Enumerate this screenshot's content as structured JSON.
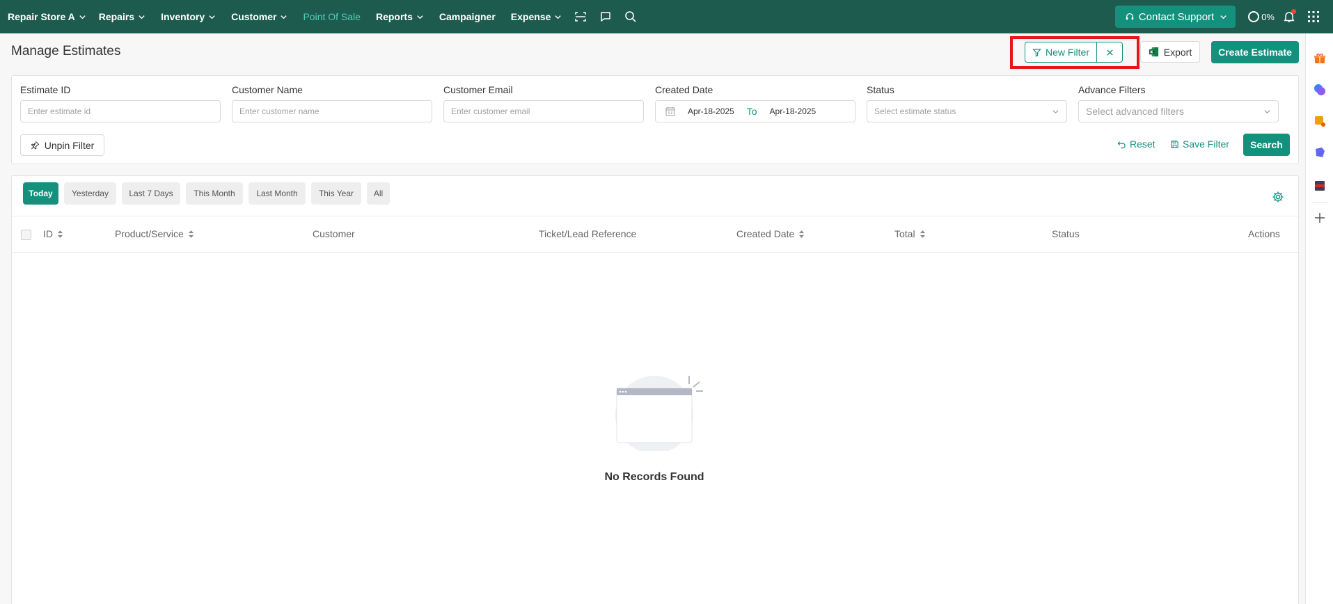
{
  "nav": {
    "store": "Repair Store A",
    "items": [
      {
        "label": "Repairs",
        "dropdown": true
      },
      {
        "label": "Inventory",
        "dropdown": true
      },
      {
        "label": "Customer",
        "dropdown": true
      },
      {
        "label": "Point Of Sale",
        "dropdown": false,
        "active": true
      },
      {
        "label": "Reports",
        "dropdown": true
      },
      {
        "label": "Campaigner",
        "dropdown": false
      },
      {
        "label": "Expense",
        "dropdown": true
      }
    ],
    "icons": [
      "scan-icon",
      "chat-icon",
      "search-icon"
    ],
    "contact_support": "Contact Support",
    "progress": "0%"
  },
  "page": {
    "title": "Manage Estimates",
    "new_filter": "New Filter",
    "export": "Export",
    "create": "Create Estimate"
  },
  "filters": {
    "estimate_id": {
      "label": "Estimate ID",
      "placeholder": "Enter estimate id"
    },
    "customer_name": {
      "label": "Customer Name",
      "placeholder": "Enter customer name"
    },
    "customer_email": {
      "label": "Customer Email",
      "placeholder": "Enter customer email"
    },
    "created_date": {
      "label": "Created Date",
      "from": "Apr-18-2025",
      "to_label": "To",
      "to": "Apr-18-2025"
    },
    "status": {
      "label": "Status",
      "placeholder": "Select estimate status"
    },
    "advance": {
      "label": "Advance Filters",
      "placeholder": "Select advanced filters"
    },
    "unpin": "Unpin Filter",
    "reset": "Reset",
    "save": "Save Filter",
    "search": "Search"
  },
  "periods": [
    "Today",
    "Yesterday",
    "Last 7 Days",
    "This Month",
    "Last Month",
    "This Year",
    "All"
  ],
  "active_period": "Today",
  "table": {
    "columns": [
      {
        "label": "ID",
        "sortable": true
      },
      {
        "label": "Product/Service",
        "sortable": true
      },
      {
        "label": "Customer",
        "sortable": false
      },
      {
        "label": "Ticket/Lead Reference",
        "sortable": false
      },
      {
        "label": "Created Date",
        "sortable": true
      },
      {
        "label": "Total",
        "sortable": true
      },
      {
        "label": "Status",
        "sortable": false
      },
      {
        "label": "Actions",
        "sortable": false
      }
    ],
    "empty": "No Records Found"
  },
  "colors": {
    "navbar": "#1e5b4f",
    "accent": "#14917d",
    "active_nav": "#4fd0b3",
    "highlight": "#e8141c"
  }
}
